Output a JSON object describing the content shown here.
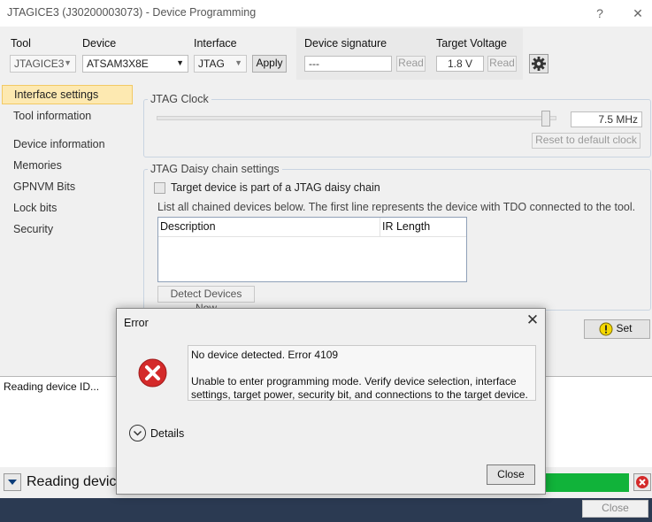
{
  "window": {
    "title": "JTAGICE3 (J30200003073) - Device Programming",
    "help": "?",
    "close": "✕"
  },
  "toolbar": {
    "tool_label": "Tool",
    "tool_value": "JTAGICE3",
    "device_label": "Device",
    "device_value": "ATSAM3X8E",
    "interface_label": "Interface",
    "interface_value": "JTAG",
    "apply": "Apply",
    "signature_label": "Device signature",
    "signature_value": "---",
    "signature_read": "Read",
    "voltage_label": "Target Voltage",
    "voltage_value": "1.8 V",
    "voltage_read": "Read"
  },
  "sidebar": {
    "items": [
      {
        "label": "Interface settings"
      },
      {
        "label": "Tool information"
      },
      {
        "label": "Device information"
      },
      {
        "label": "Memories"
      },
      {
        "label": "GPNVM Bits"
      },
      {
        "label": "Lock bits"
      },
      {
        "label": "Security"
      }
    ]
  },
  "jtag_clock": {
    "title": "JTAG Clock",
    "value": "7.5 MHz",
    "reset": "Reset to default clock",
    "slider_level": 0.985
  },
  "daisy": {
    "title": "JTAG Daisy chain settings",
    "checkbox_label": "Target device is part of a JTAG daisy chain",
    "hint": "List all chained devices below. The first line represents the device with TDO connected to the tool.",
    "col_description": "Description",
    "col_ir_length": "IR Length",
    "detect": "Detect Devices Now"
  },
  "set_button": "Set",
  "log": {
    "line": "Reading device ID..."
  },
  "status": {
    "text": "Reading device"
  },
  "bottom": {
    "close": "Close"
  },
  "dialog": {
    "title": "Error",
    "msg1": "No device detected. Error 4109",
    "msg2": "Unable to enter programming mode. Verify device selection, interface settings, target power, security bit, and connections to the target device.",
    "details": "Details",
    "close": "Close"
  },
  "colors": {
    "accent_selected": "#fde9b1",
    "progress_green": "#11b33a",
    "error_red": "#d42a2a",
    "warning_yellow": "#f5d800"
  },
  "icons": [
    "gear-icon",
    "error-icon",
    "warning-icon",
    "expand-chevron-icon",
    "cancel-icon",
    "dropdown-arrow-icon"
  ]
}
